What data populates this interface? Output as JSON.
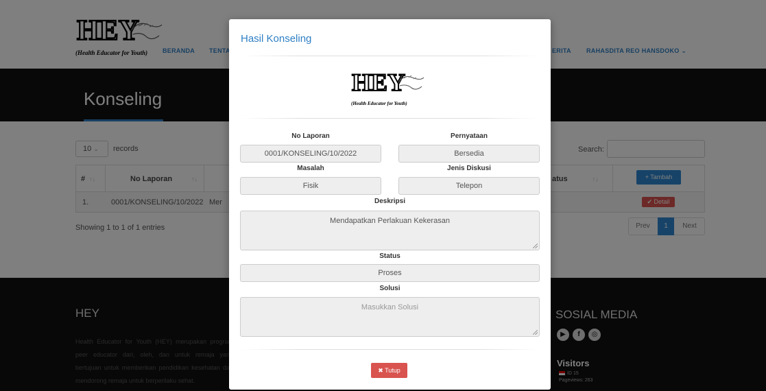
{
  "brand": {
    "logo_text": "HEY",
    "tagline": "(Health Educator for Youth)"
  },
  "nav": {
    "items": [
      "BERANDA",
      "TENTA",
      "ERITA",
      "RAHASDITA REO HANSDOKO ⌄"
    ]
  },
  "page": {
    "title": "Konseling"
  },
  "table_controls": {
    "length_value": "10",
    "length_label": "records",
    "search_label": "Search:"
  },
  "table": {
    "columns": [
      "#",
      "No Laporan",
      "atus"
    ],
    "rows": [
      {
        "index": "1.",
        "no_laporan": "0001/KONSELING/10/2022",
        "partial": "Mer"
      }
    ],
    "add_button": "+ Tambah",
    "detail_button": "✔ Detail"
  },
  "pagination": {
    "showing": "Showing 1 to 1 of 1 entries",
    "prev": "Prev",
    "current": "1",
    "next": "Next"
  },
  "footer": {
    "title": "HEY",
    "description": "Health Educator for Youth (HEY) merupakan program peer educator dari, oleh, dan untuk remaja yang bertujuan untuk memberikan pendidikan kesehatan dan mendorong remaja untuk berperilaku sehat.",
    "social_title": "SOSIAL MEDIA",
    "social_icons": [
      "youtube-icon",
      "facebook-icon",
      "instagram-icon"
    ],
    "visitors_title": "Visitors",
    "visitors_country": "ID 15",
    "pageviews": "Pageviews: 263"
  },
  "modal": {
    "title": "Hasil Konseling",
    "fields": {
      "no_laporan_label": "No Laporan",
      "no_laporan_value": "0001/KONSELING/10/2022",
      "pernyataan_label": "Pernyataan",
      "pernyataan_value": "Bersedia",
      "masalah_label": "Masalah",
      "masalah_value": "Fisik",
      "jenis_diskusi_label": "Jenis Diskusi",
      "jenis_diskusi_value": "Telepon",
      "deskripsi_label": "Deskripsi",
      "deskripsi_value": "Mendapatkan Perlakuan Kekerasan",
      "status_label": "Status",
      "status_value": "Proses",
      "solusi_label": "Solusi",
      "solusi_placeholder": "Masukkan Solusi"
    },
    "close_button": "✖ Tutup"
  },
  "colors": {
    "accent": "#2e7fc4",
    "danger": "#d9534f",
    "dark": "#111111"
  }
}
